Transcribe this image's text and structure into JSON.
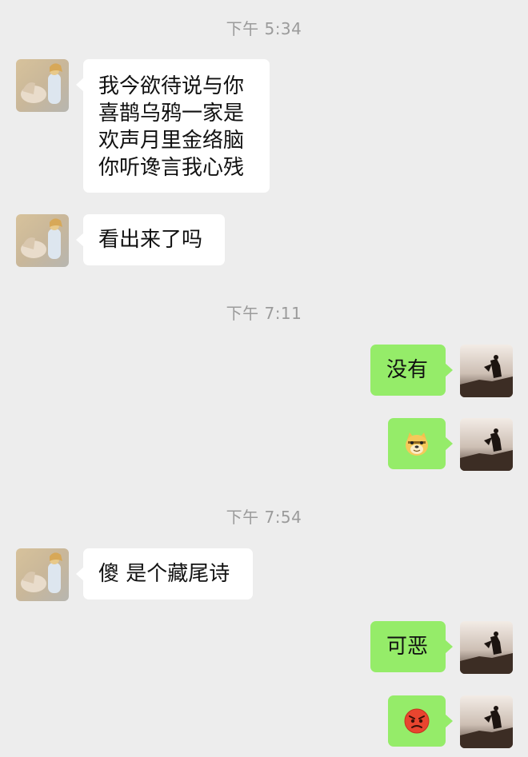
{
  "colors": {
    "background": "#ededed",
    "incoming_bubble": "#ffffff",
    "outgoing_bubble": "#95ec69",
    "timestamp_text": "#9b9b9b"
  },
  "chat": {
    "timestamps": [
      "下午 5:34",
      "下午 7:11",
      "下午 7:54"
    ],
    "messages": [
      {
        "side": "incoming",
        "lines": [
          "我今欲待说与你",
          "喜鹊乌鸦一家是",
          "欢声月里金络脑",
          "你听谗言我心残"
        ]
      },
      {
        "side": "incoming",
        "text": "看出来了吗"
      },
      {
        "side": "outgoing",
        "text": "没有"
      },
      {
        "side": "outgoing",
        "emoji": "doge-emoji"
      },
      {
        "side": "incoming",
        "text": "傻 是个藏尾诗"
      },
      {
        "side": "outgoing",
        "text": "可恶"
      },
      {
        "side": "outgoing",
        "emoji": "angry-face-emoji"
      }
    ],
    "avatars": {
      "contact": "contact-avatar-girl-with-horse",
      "self": "self-avatar-figure-on-rock"
    }
  }
}
